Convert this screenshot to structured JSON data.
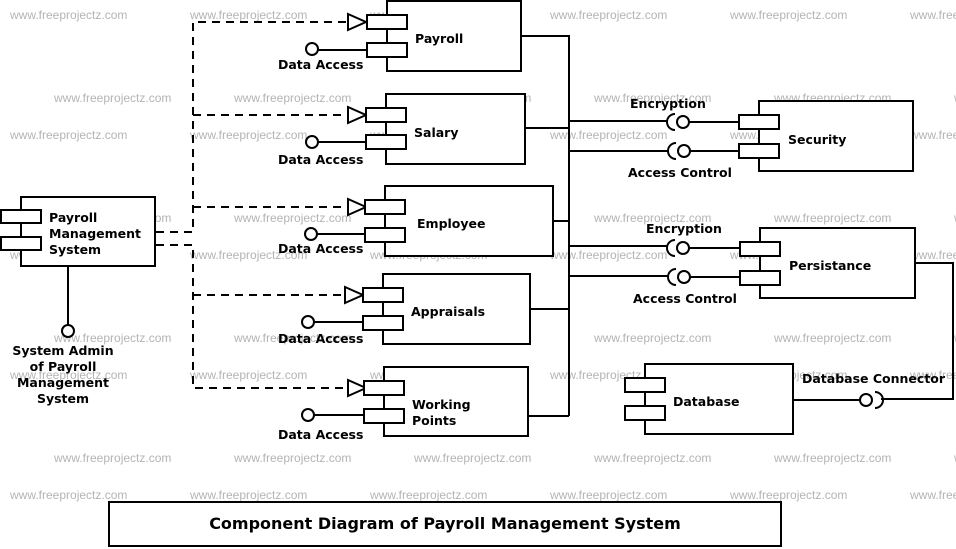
{
  "watermark": "www.freeprojectz.com",
  "title": "Component Diagram of Payroll Management System",
  "components": {
    "pms": [
      "Payroll",
      "Management",
      "System"
    ],
    "payroll": [
      "Payroll"
    ],
    "salary": [
      "Salary"
    ],
    "employee": [
      "Employee"
    ],
    "appraisals": [
      "Appraisals"
    ],
    "working_points": [
      "Working",
      "Points"
    ],
    "security": [
      "Security"
    ],
    "persistance": [
      "Persistance"
    ],
    "database": [
      "Database"
    ]
  },
  "interfaces": {
    "system_admin": [
      "System Admin",
      "of Payroll",
      "Management",
      "System"
    ],
    "data_access": "Data Access",
    "encryption": "Encryption",
    "access_control": "Access Control",
    "database_connector": "Database Connector"
  }
}
